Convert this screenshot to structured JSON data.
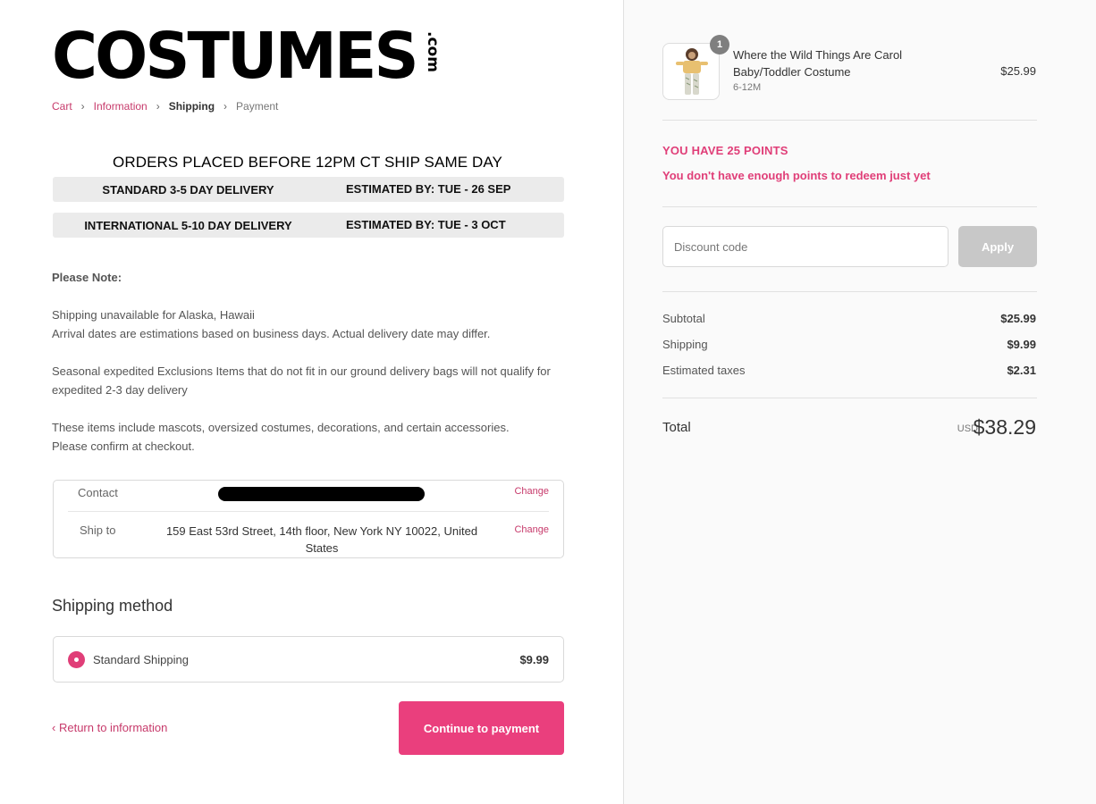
{
  "brand": {
    "logo_main": "COSTUMES",
    "logo_suffix": ".com"
  },
  "breadcrumb": {
    "cart": "Cart",
    "information": "Information",
    "shipping": "Shipping",
    "payment": "Payment"
  },
  "shipping_banner": {
    "heading": "ORDERS PLACED BEFORE 12PM CT SHIP SAME DAY",
    "rows": [
      {
        "label": "STANDARD 3-5 DAY DELIVERY",
        "estimate": "ESTIMATED BY: TUE - 26 SEP"
      },
      {
        "label": "INTERNATIONAL 5-10 DAY DELIVERY",
        "estimate": "ESTIMATED BY: TUE - 3 OCT"
      }
    ]
  },
  "notes": {
    "title": "Please Note:",
    "line1": "Shipping unavailable for Alaska, Hawaii",
    "line2": "Arrival dates are estimations based on business days. Actual delivery date may differ.",
    "line3": "Seasonal expedited Exclusions Items that do not fit in our ground delivery bags will not qualify for expedited 2-3 day delivery",
    "line4": "These items include mascots, oversized costumes, decorations, and certain accessories.",
    "line5": "Please confirm at checkout."
  },
  "review": {
    "contact_label": "Contact",
    "shipto_label": "Ship to",
    "shipto_value": "159 East 53rd Street, 14th floor, New York NY 10022, United States",
    "change_label": "Change"
  },
  "shipping_method": {
    "title": "Shipping method",
    "option_name": "Standard Shipping",
    "option_price": "$9.99"
  },
  "actions": {
    "return_label": "Return to information",
    "continue_label": "Continue to payment"
  },
  "cart": {
    "quantity": "1",
    "product_name": "Where the Wild Things Are Carol Baby/Toddler Costume",
    "variant": "6-12M",
    "price": "$25.99"
  },
  "points": {
    "title": "YOU HAVE 25 POINTS",
    "message": "You don't have enough points to redeem just yet"
  },
  "discount": {
    "placeholder": "Discount code",
    "apply_label": "Apply"
  },
  "summary": {
    "subtotal_label": "Subtotal",
    "subtotal": "$25.99",
    "shipping_label": "Shipping",
    "shipping": "$9.99",
    "taxes_label": "Estimated taxes",
    "taxes": "$2.31",
    "total_label": "Total",
    "currency": "USD",
    "total": "$38.29"
  },
  "colors": {
    "accent": "#ea3f7d",
    "link": "#c73a6b",
    "banner_bg": "#ebebeb",
    "sidebar_bg": "#fafafa"
  }
}
